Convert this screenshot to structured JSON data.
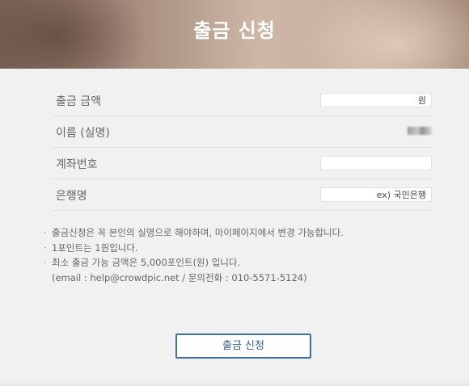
{
  "header": {
    "title": "출금 신청"
  },
  "form": {
    "amount_label": "출금 금액",
    "amount_suffix": "원",
    "name_label": "이름 (실명)",
    "account_label": "계좌번호",
    "bank_label": "은행명",
    "bank_placeholder": "ex) 국민은행"
  },
  "notes": [
    "출금신청은 꼭 본인의 실명으로 해야하며, 마이페이지에서 변경 가능합니다.",
    "1포인트는 1원입니다.",
    "최소 출금 가능 금액은 5,000포인트(원) 입니다.",
    "(email : help@crowdpic.net / 문의전화 : 010-5571-5124)"
  ],
  "bullet": "·",
  "submit_label": "출금 신청"
}
